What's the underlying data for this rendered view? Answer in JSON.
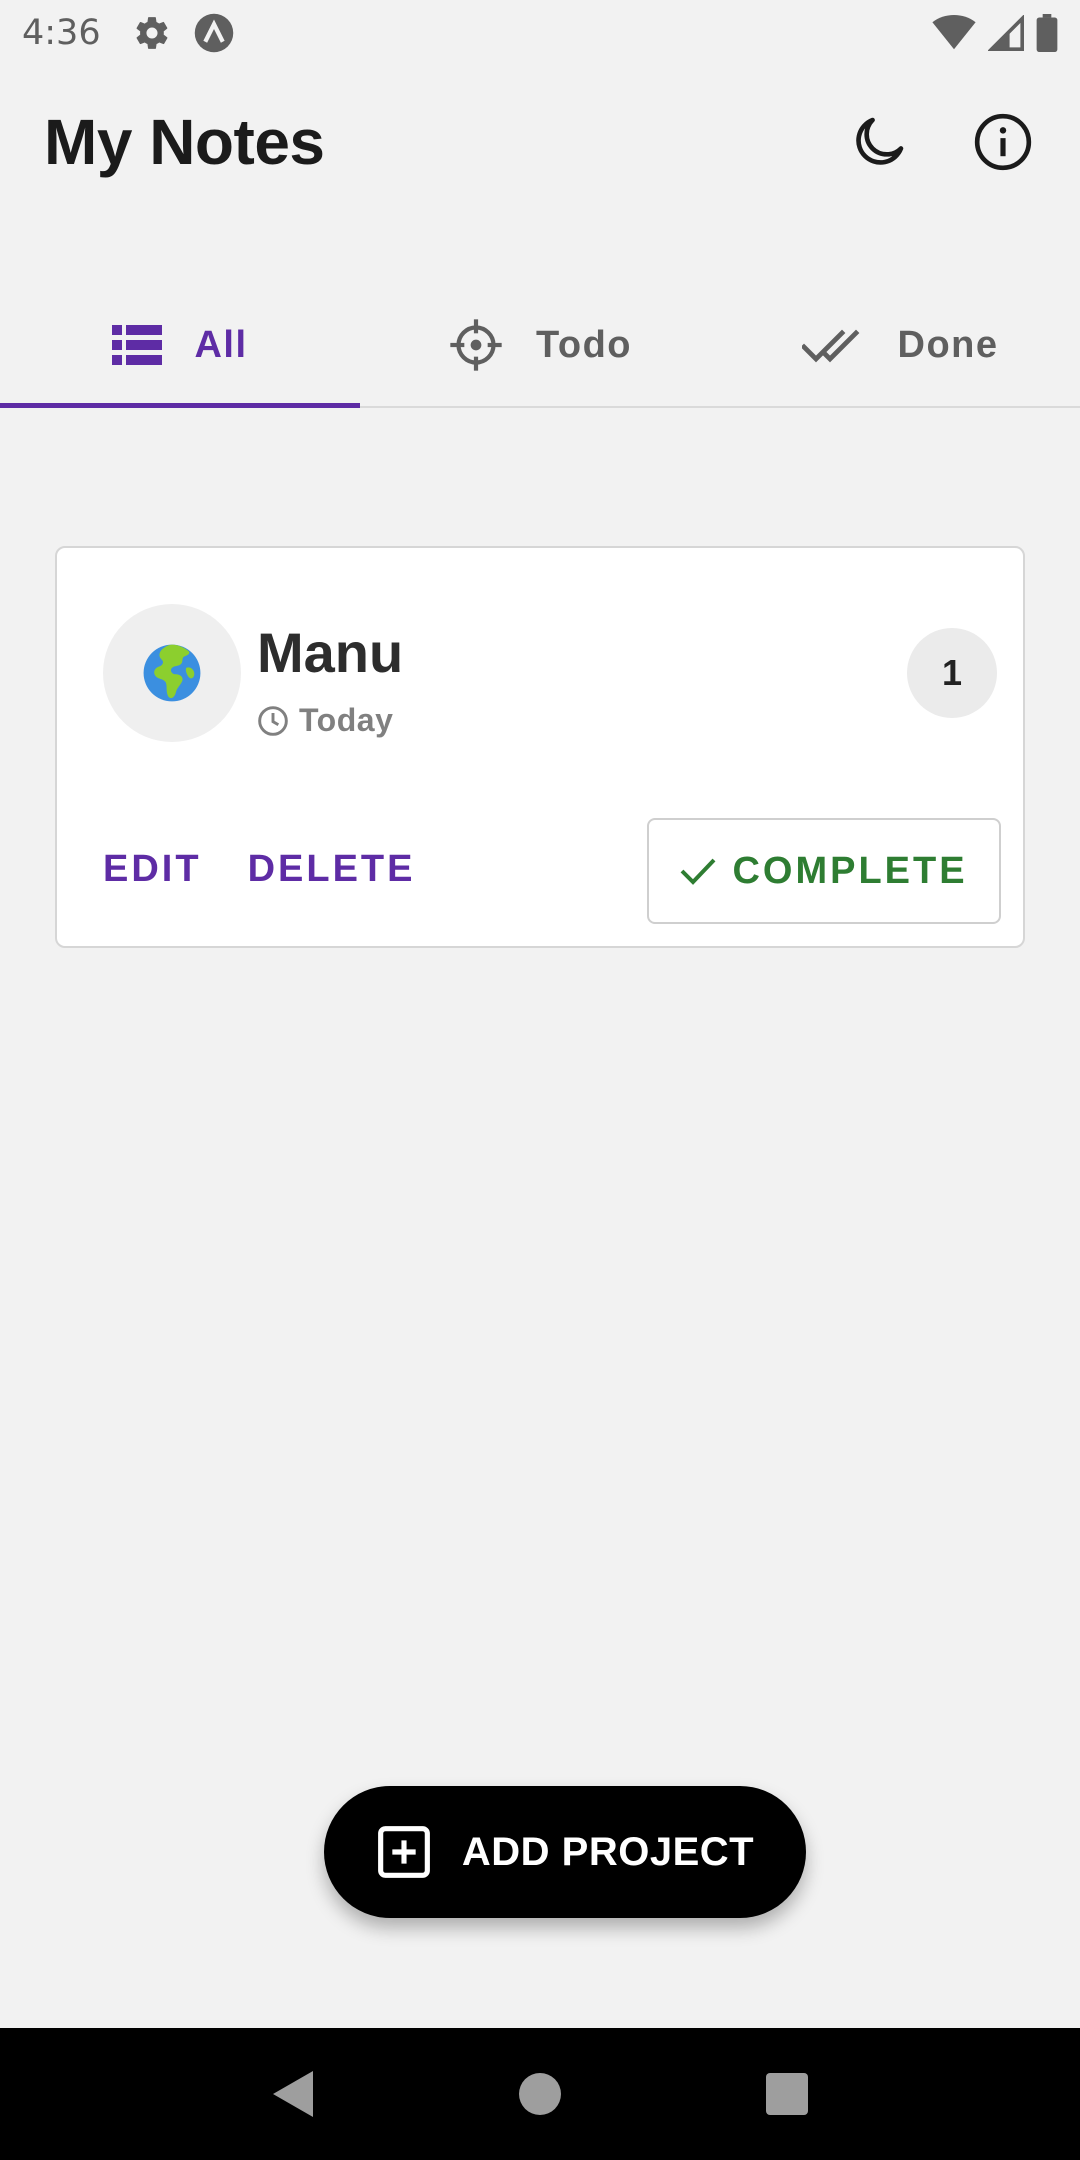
{
  "status_bar": {
    "time": "4:36",
    "icons": [
      "settings-icon",
      "app-logo-icon",
      "wifi-icon",
      "cell-signal-icon",
      "battery-icon"
    ]
  },
  "header": {
    "title": "My Notes",
    "actions": [
      "dark-mode-moon-icon",
      "info-icon"
    ]
  },
  "tabs": [
    {
      "label": "All",
      "icon": "list-icon",
      "active": true
    },
    {
      "label": "Todo",
      "icon": "crosshair-icon",
      "active": false
    },
    {
      "label": "Done",
      "icon": "double-check-icon",
      "active": false
    }
  ],
  "project": {
    "emoji": "🌍",
    "name": "Manu",
    "date": "Today",
    "count": "1",
    "edit_label": "EDIT",
    "delete_label": "DELETE",
    "complete_label": "COMPLETE"
  },
  "fab": {
    "label": "ADD PROJECT",
    "icon": "plus-square-icon"
  },
  "nav_bar": [
    "back-icon",
    "home-icon",
    "recents-icon"
  ],
  "colors": {
    "primary": "#5e2ca5",
    "success": "#2e7d32",
    "background": "#f2f2f2",
    "card": "#ffffff",
    "fab": "#000000"
  }
}
